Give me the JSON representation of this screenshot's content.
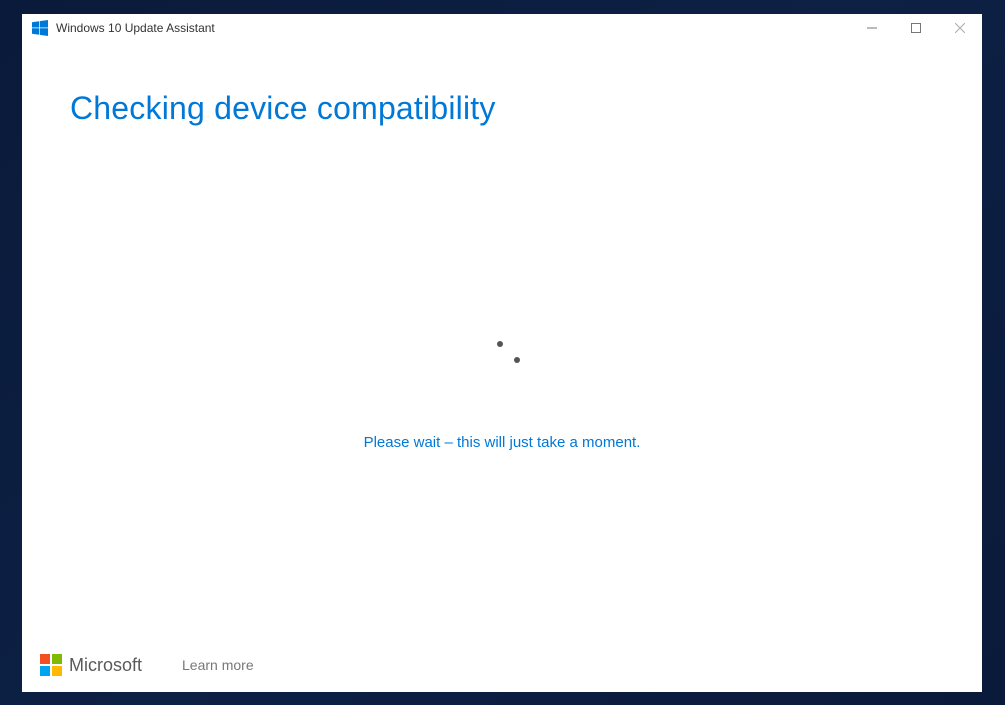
{
  "titlebar": {
    "title": "Windows 10 Update Assistant"
  },
  "content": {
    "heading": "Checking device compatibility",
    "status": "Please wait – this will just take a moment."
  },
  "footer": {
    "brand": "Microsoft",
    "learn_more": "Learn more"
  }
}
